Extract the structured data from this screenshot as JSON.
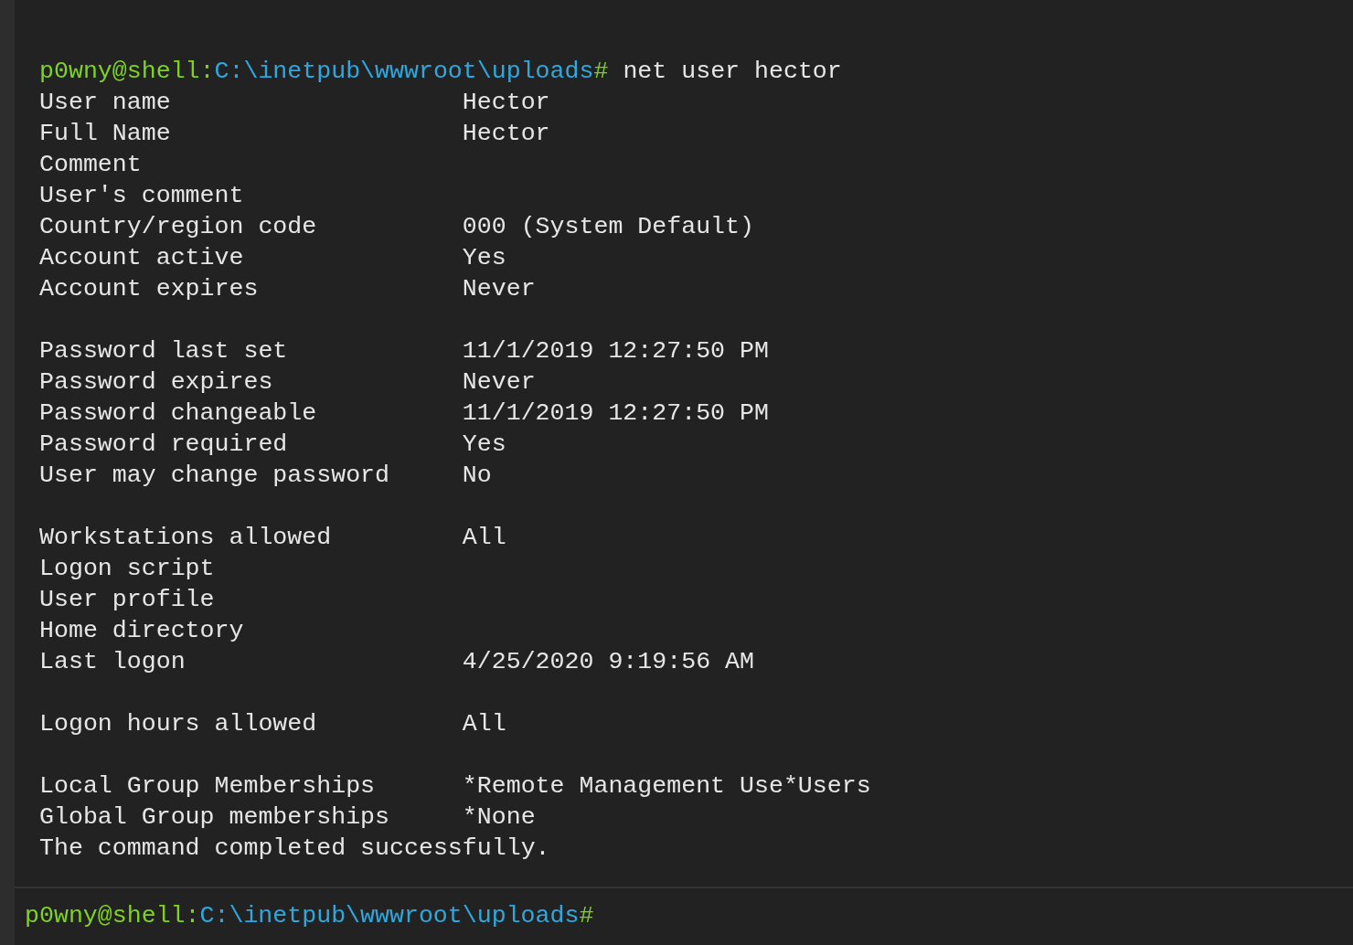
{
  "output": {
    "prompt": {
      "user_host": "p0wny@shell:",
      "path": "C:\\inetpub\\wwwroot\\uploads",
      "symbol": "#"
    },
    "command": "net user hector",
    "lines": [
      {
        "kind": "field",
        "label": "User name",
        "value": "Hector"
      },
      {
        "kind": "field",
        "label": "Full Name",
        "value": "Hector"
      },
      {
        "kind": "field",
        "label": "Comment"
      },
      {
        "kind": "field",
        "label": "User's comment"
      },
      {
        "kind": "field",
        "label": "Country/region code",
        "value": "000 (System Default)"
      },
      {
        "kind": "field",
        "label": "Account active",
        "value": "Yes"
      },
      {
        "kind": "field",
        "label": "Account expires",
        "value": "Never"
      },
      {
        "kind": "blank"
      },
      {
        "kind": "field",
        "label": "Password last set",
        "value": "11/1/2019 12:27:50 PM"
      },
      {
        "kind": "field",
        "label": "Password expires",
        "value": "Never"
      },
      {
        "kind": "field",
        "label": "Password changeable",
        "value": "11/1/2019 12:27:50 PM"
      },
      {
        "kind": "field",
        "label": "Password required",
        "value": "Yes"
      },
      {
        "kind": "field",
        "label": "User may change password",
        "value": "No"
      },
      {
        "kind": "blank"
      },
      {
        "kind": "field",
        "label": "Workstations allowed",
        "value": "All"
      },
      {
        "kind": "field",
        "label": "Logon script"
      },
      {
        "kind": "field",
        "label": "User profile"
      },
      {
        "kind": "field",
        "label": "Home directory"
      },
      {
        "kind": "field",
        "label": "Last logon",
        "value": "4/25/2020 9:19:56 AM"
      },
      {
        "kind": "blank"
      },
      {
        "kind": "field",
        "label": "Logon hours allowed",
        "value": "All"
      },
      {
        "kind": "blank"
      },
      {
        "kind": "field",
        "label": "Local Group Memberships",
        "value": "*Remote Management Use*Users"
      },
      {
        "kind": "field",
        "label": "Global Group memberships",
        "value": "*None"
      },
      {
        "kind": "text",
        "text": "The command completed successfully."
      }
    ]
  },
  "input": {
    "prompt": {
      "user_host": "p0wny@shell:",
      "path": "C:\\inetpub\\wwwroot\\uploads",
      "symbol": "#"
    }
  }
}
